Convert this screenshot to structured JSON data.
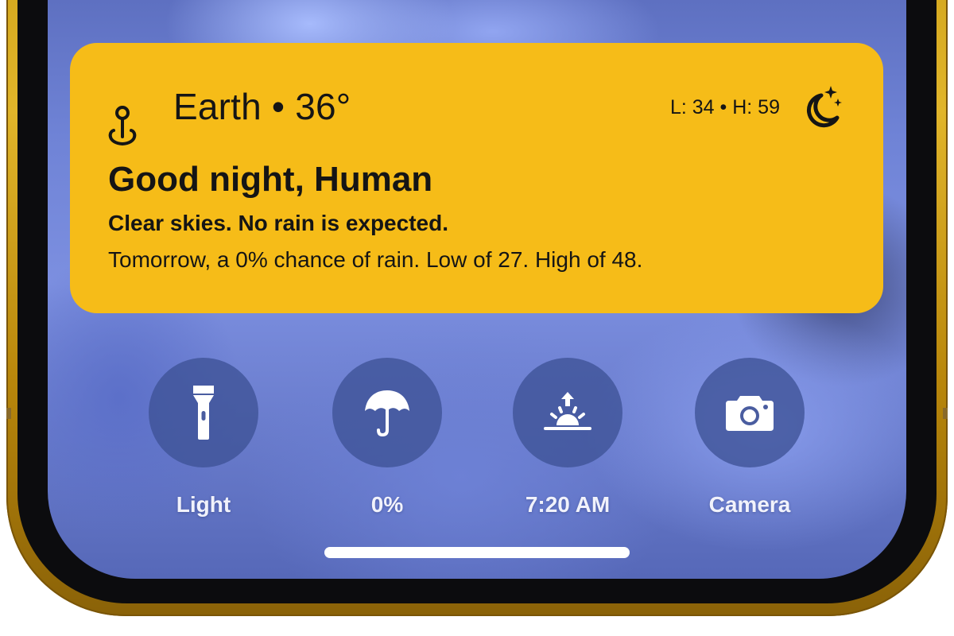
{
  "weather": {
    "location": "Earth",
    "temperature": "36°",
    "location_line": "Earth • 36°",
    "hilo": "L: 34 • H: 59",
    "greeting": "Good night, Human",
    "summary": "Clear skies. No rain is expected.",
    "forecast": "Tomorrow, a 0% chance of rain. Low of 27. High of 48.",
    "location_icon": "location-pin-icon",
    "condition_icon": "moon-stars-icon",
    "background_color": "#f6bc18"
  },
  "actions": [
    {
      "label": "Light",
      "icon": "flashlight-icon"
    },
    {
      "label": "0%",
      "icon": "umbrella-icon"
    },
    {
      "label": "7:20 AM",
      "icon": "sunrise-icon"
    },
    {
      "label": "Camera",
      "icon": "camera-icon"
    }
  ],
  "colors": {
    "frame": "#e1b52a",
    "action_circle": "#3e5296",
    "label": "#f1f2fb"
  }
}
